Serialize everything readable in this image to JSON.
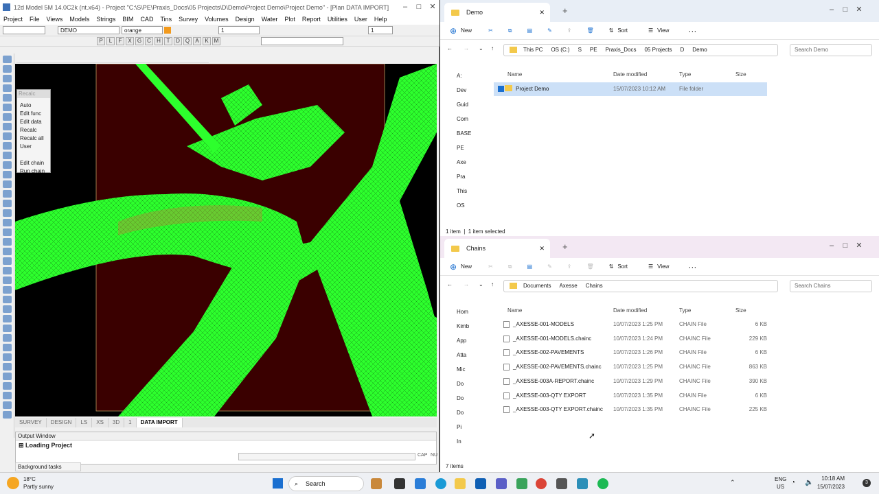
{
  "cad": {
    "title": "12d Model 5M 14.0C2k (nt.x64) - Project \"C:\\S\\PE\\Praxis_Docs\\05 Projects\\D\\Demo\\Project Demo\\Project Demo\" - [Plan DATA IMPORT]",
    "menu": [
      "Project",
      "File",
      "Views",
      "Models",
      "Strings",
      "BIM",
      "CAD",
      "Tins",
      "Survey",
      "Volumes",
      "Design",
      "Water",
      "Plot",
      "Report",
      "Utilities",
      "User",
      "Help"
    ],
    "toolbar": {
      "model": "DEMO",
      "colour": "orange",
      "value": "1",
      "value2": "1"
    },
    "toolbar2_letters": [
      "P",
      "L",
      "F",
      "X",
      "G",
      "C",
      "H",
      "T",
      "D",
      "Q",
      "A",
      "K",
      "M"
    ],
    "recalc_menu": {
      "header": "Recalc",
      "items": [
        "Auto",
        "Edit func",
        "Edit data",
        "Recalc",
        "Recalc all",
        "User",
        "Edit chain",
        "Run chain"
      ]
    },
    "view_tabs": [
      "SURVEY",
      "DESIGN",
      "LS",
      "XS",
      "3D",
      "1",
      "DATA IMPORT"
    ],
    "output_window": {
      "title": "Output Window",
      "line": "Loading Project"
    },
    "status": {
      "bg_tasks": "Background tasks",
      "caps": "CAP",
      "num": "NU"
    }
  },
  "explorer_top": {
    "tab": "Demo",
    "new": "New",
    "sort": "Sort",
    "view": "View",
    "crumbs": [
      "This PC",
      "OS (C:)",
      "S",
      "PE",
      "Praxis_Docs",
      "05 Projects",
      "D",
      "Demo"
    ],
    "search": "Search Demo",
    "nav": [
      "A:",
      "Dev",
      "Guid",
      "Com",
      "BASE",
      "PE",
      "Axe",
      "Pra",
      "This",
      "OS"
    ],
    "columns": [
      "Name",
      "Date modified",
      "Type",
      "Size"
    ],
    "rows": [
      {
        "name": "Project Demo",
        "date": "15/07/2023 10:12 AM",
        "type": "File folder",
        "size": ""
      }
    ],
    "status1": "1 item",
    "status2": "1 item selected"
  },
  "explorer_bottom": {
    "tab": "Chains",
    "new": "New",
    "sort": "Sort",
    "view": "View",
    "crumbs": [
      "Documents",
      "Axesse",
      "Chains"
    ],
    "search": "Search Chains",
    "nav": [
      "Hom",
      "Kimb",
      "App",
      "Atta",
      "Mic",
      "Do",
      "Do",
      "Do",
      "Pi",
      "In"
    ],
    "columns": [
      "Name",
      "Date modified",
      "Type",
      "Size"
    ],
    "rows": [
      {
        "name": "_AXESSE-001-MODELS",
        "date": "10/07/2023 1:25 PM",
        "type": "CHAIN File",
        "size": "6 KB"
      },
      {
        "name": "_AXESSE-001-MODELS.chainc",
        "date": "10/07/2023 1:24 PM",
        "type": "CHAINC File",
        "size": "229 KB"
      },
      {
        "name": "_AXESSE-002-PAVEMENTS",
        "date": "10/07/2023 1:26 PM",
        "type": "CHAIN File",
        "size": "6 KB"
      },
      {
        "name": "_AXESSE-002-PAVEMENTS.chainc",
        "date": "10/07/2023 1:25 PM",
        "type": "CHAINC File",
        "size": "863 KB"
      },
      {
        "name": "_AXESSE-003A-REPORT.chainc",
        "date": "10/07/2023 1:29 PM",
        "type": "CHAINC File",
        "size": "390 KB"
      },
      {
        "name": "_AXESSE-003-QTY EXPORT",
        "date": "10/07/2023 1:35 PM",
        "type": "CHAIN File",
        "size": "6 KB"
      },
      {
        "name": "_AXESSE-003-QTY EXPORT.chainc",
        "date": "10/07/2023 1:35 PM",
        "type": "CHAINC File",
        "size": "225 KB"
      }
    ],
    "status1": "7 items"
  },
  "taskbar": {
    "weather_temp": "18°C",
    "weather_desc": "Partly sunny",
    "search": "Search",
    "lang": "ENG",
    "region": "US",
    "time": "10:18 AM",
    "date": "15/07/2023",
    "badge": "3"
  }
}
